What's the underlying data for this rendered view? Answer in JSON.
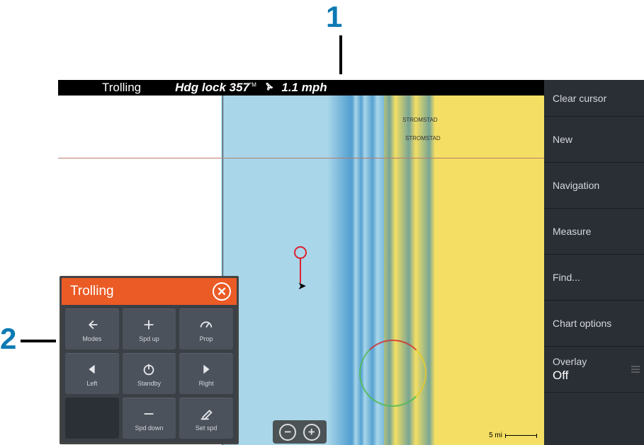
{
  "callouts": {
    "one": "1",
    "two": "2"
  },
  "header": {
    "title": "Trolling",
    "status_prefix": "Hdg lock",
    "heading": "357",
    "unit_m": "°M",
    "speed": "1.1",
    "speed_unit": "mph"
  },
  "sidebar": {
    "items": [
      {
        "label": "Clear cursor"
      },
      {
        "label": "New"
      },
      {
        "label": "Navigation"
      },
      {
        "label": "Measure"
      },
      {
        "label": "Find..."
      },
      {
        "label": "Chart options"
      },
      {
        "label": "Overlay",
        "value": "Off"
      }
    ]
  },
  "trolling_panel": {
    "title": "Trolling",
    "buttons": {
      "modes": "Modes",
      "spdup": "Spd up",
      "prop": "Prop",
      "left": "Left",
      "standby": "Standby",
      "right": "Right",
      "spddown": "Spd down",
      "setspd": "Set spd"
    }
  },
  "zoom": {
    "out": "−",
    "in": "+"
  },
  "chart": {
    "label_stromstad_1": "STROMSTAD",
    "label_stromstad_2": "STROMSTAD",
    "scale": "5 mi"
  }
}
